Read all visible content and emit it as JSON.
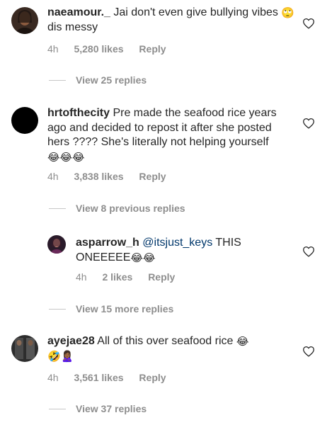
{
  "comments": [
    {
      "username": "naeamour._",
      "text": " Jai don't even give bullying vibes ",
      "emoji": "🙄",
      "text_after": " dis messy",
      "time": "4h",
      "likes": "5,280 likes",
      "reply": "Reply",
      "view_replies": "View 25 replies"
    },
    {
      "username": "hrtofthecity",
      "text": " Pre made the seafood rice years ago and decided to repost it after she posted hers ???? She's  literally not helping yourself ",
      "emoji": "😂😂😂",
      "time": "4h",
      "likes": "3,838 likes",
      "reply": "Reply",
      "view_replies": "View 8 previous replies",
      "reply_comment": {
        "username": "asparrow_h",
        "mention": "@itsjust_keys",
        "text": " THIS ONEEEEE",
        "emoji": "😂😂",
        "time": "4h",
        "likes": "2 likes",
        "reply": "Reply"
      },
      "view_more": "View 15 more replies"
    },
    {
      "username": "ayejae28",
      "text": " All of this over seafood rice ",
      "emoji": "😂",
      "emoji2": "🤣🙎🏾‍♀️",
      "time": "4h",
      "likes": "3,561 likes",
      "reply": "Reply",
      "view_replies": "View 37 replies"
    }
  ],
  "colors": {
    "text": "#262626",
    "secondary": "#8e8e8e",
    "mention": "#00376b"
  },
  "icons": [
    "heart-outline-icon"
  ]
}
